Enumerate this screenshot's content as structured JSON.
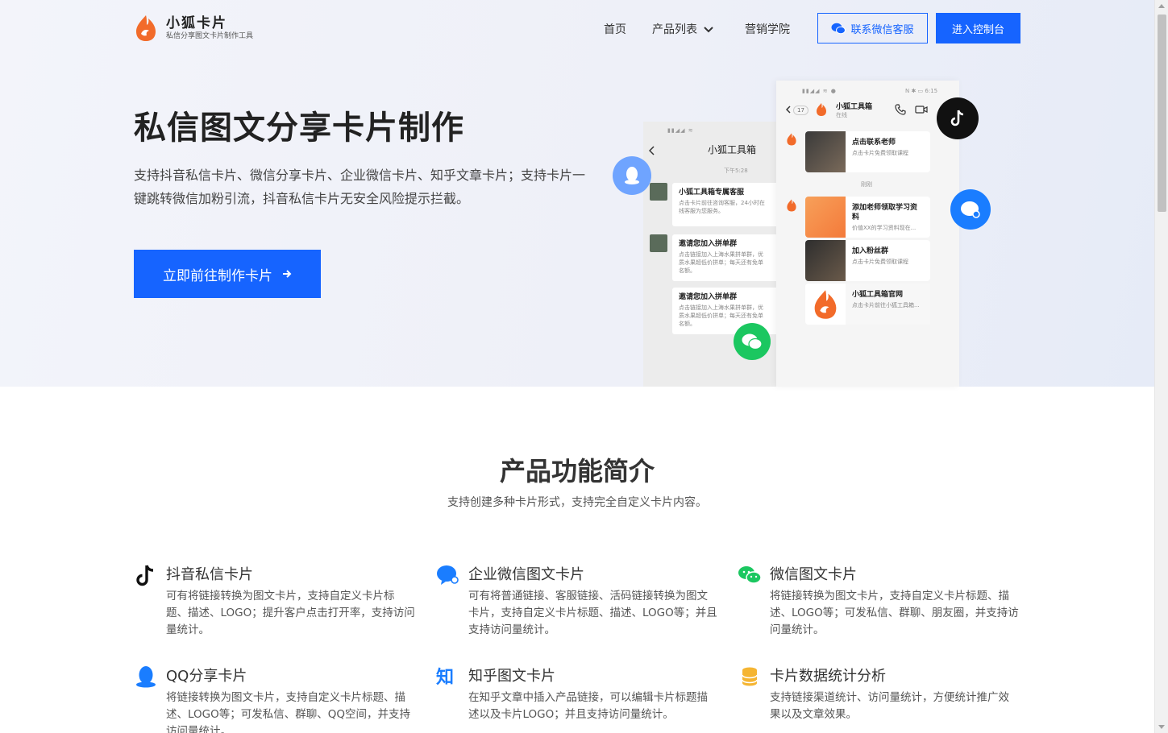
{
  "brand": {
    "name": "小狐卡片",
    "tagline": "私信分享图文卡片制作工具",
    "accent": "#1664ff",
    "logo_color": "#f26b2a"
  },
  "nav": {
    "home": "首页",
    "products": "产品列表",
    "academy": "营销学院",
    "contact_button": "联系微信客服",
    "console_button": "进入控制台"
  },
  "hero": {
    "title": "私信图文分享卡片制作",
    "description": "支持抖音私信卡片、微信分享卡片、企业微信卡片、知乎文章卡片；支持卡片一键跳转微信加粉引流，抖音私信卡片无安全风险提示拦截。",
    "cta": "立即前往制作卡片"
  },
  "mock_back": {
    "title": "小狐工具箱",
    "time": "下午5:28",
    "messages": [
      {
        "title": "小狐工具箱专属客服",
        "desc": "点击卡片前往咨询客服，24小时在线客服为您服务。"
      },
      {
        "title": "邀请您加入拼单群",
        "desc": "点击链接加入上海水果拼单群，优质水果超低价拼单；每天还有免单名额。"
      },
      {
        "title": "邀请您加入拼单群",
        "desc": "点击链接加入上海水果拼单群，优质水果超低价拼单；每天还有免单名额。"
      }
    ]
  },
  "mock_front": {
    "status_time": "6:15",
    "back_count": "17",
    "title": "小狐工具箱",
    "status": "在线",
    "divider": "刚刚",
    "cards": [
      {
        "title": "点击联系老师",
        "desc": "点击卡片免费领取课程"
      },
      {
        "title": "添加老师领取学习资料",
        "desc": "价值XX的学习资料现在..."
      },
      {
        "title": "加入粉丝群",
        "desc": "点击卡片免费领取课程"
      },
      {
        "title": "小狐工具箱官网",
        "desc": "点击卡片前往小狐工具箱..."
      }
    ]
  },
  "features_section": {
    "title": "产品功能简介",
    "subtitle": "支持创建多种卡片形式，支持完全自定义卡片内容。"
  },
  "features": [
    {
      "icon": "tiktok-icon",
      "title": "抖音私信卡片",
      "desc": "可有将链接转换为图文卡片，支持自定义卡片标题、描述、LOGO；提升客户点击打开率，支持访问量统计。"
    },
    {
      "icon": "wecom-icon",
      "title": "企业微信图文卡片",
      "desc": "可有将普通链接、客服链接、活码链接转换为图文卡片，支持自定义卡片标题、描述、LOGO等；并且支持访问量统计。"
    },
    {
      "icon": "wechat-icon",
      "title": "微信图文卡片",
      "desc": "将链接转换为图文卡片，支持自定义卡片标题、描述、LOGO等；可发私信、群聊、朋友圈，并支持访问量统计。"
    },
    {
      "icon": "qq-icon",
      "title": "QQ分享卡片",
      "desc": "将链接转换为图文卡片，支持自定义卡片标题、描述、LOGO等；可发私信、群聊、QQ空间，并支持访问量统计。"
    },
    {
      "icon": "zhihu-icon",
      "title": "知乎图文卡片",
      "desc": "在知乎文章中插入产品链接，可以编辑卡片标题描述以及卡片LOGO；并且支持访问量统计。"
    },
    {
      "icon": "database-icon",
      "title": "卡片数据统计分析",
      "desc": "支持链接渠道统计、访问量统计，方便统计推广效果以及文章效果。"
    }
  ]
}
